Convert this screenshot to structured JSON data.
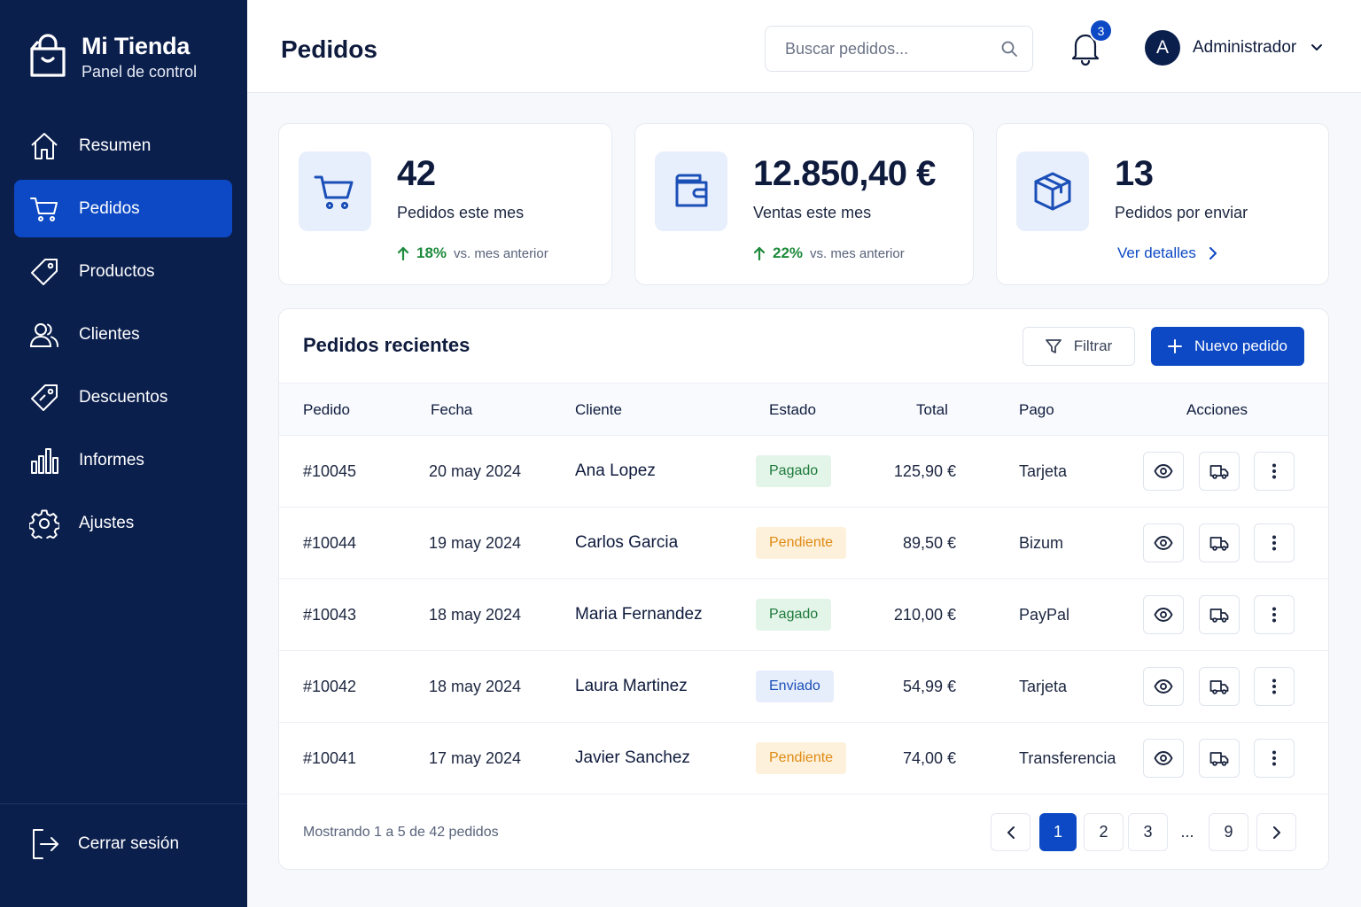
{
  "brand": {
    "name": "Mi Tienda",
    "subtitle": "Panel de control"
  },
  "sidebar": {
    "items": [
      {
        "label": "Resumen",
        "icon": "home-icon",
        "active": false
      },
      {
        "label": "Pedidos",
        "icon": "cart-icon",
        "active": true
      },
      {
        "label": "Productos",
        "icon": "tag-icon",
        "active": false
      },
      {
        "label": "Clientes",
        "icon": "users-icon",
        "active": false
      },
      {
        "label": "Descuentos",
        "icon": "discount-tag-icon",
        "active": false
      },
      {
        "label": "Informes",
        "icon": "bar-chart-icon",
        "active": false
      },
      {
        "label": "Ajustes",
        "icon": "gear-icon",
        "active": false
      }
    ],
    "logout_label": "Cerrar sesión"
  },
  "header": {
    "title": "Pedidos",
    "search_placeholder": "Buscar pedidos...",
    "notifications_count": "3",
    "user_initial": "A",
    "user_name": "Administrador"
  },
  "stats": [
    {
      "value": "42",
      "label": "Pedidos este mes",
      "trend_value": "18%",
      "trend_text": "vs. mes anterior",
      "icon": "cart-icon"
    },
    {
      "value": "12.850,40 €",
      "label": "Ventas este mes",
      "trend_value": "22%",
      "trend_text": "vs. mes anterior",
      "icon": "wallet-icon"
    },
    {
      "value": "13",
      "label": "Pedidos por enviar",
      "link_label": "Ver detalles",
      "icon": "package-icon"
    }
  ],
  "orders": {
    "title": "Pedidos recientes",
    "filter_label": "Filtrar",
    "new_label": "Nuevo pedido",
    "columns": [
      "Pedido",
      "Fecha",
      "Cliente",
      "Estado",
      "Total",
      "Pago",
      "Acciones"
    ],
    "rows": [
      {
        "id": "#10045",
        "date": "20 may 2024",
        "customer": "Ana Lopez",
        "status": "Pagado",
        "status_type": "paid",
        "total": "125,90 €",
        "payment": "Tarjeta"
      },
      {
        "id": "#10044",
        "date": "19 may 2024",
        "customer": "Carlos Garcia",
        "status": "Pendiente",
        "status_type": "pending",
        "total": "89,50 €",
        "payment": "Bizum"
      },
      {
        "id": "#10043",
        "date": "18 may 2024",
        "customer": "Maria Fernandez",
        "status": "Pagado",
        "status_type": "paid",
        "total": "210,00 €",
        "payment": "PayPal"
      },
      {
        "id": "#10042",
        "date": "18 may 2024",
        "customer": "Laura Martinez",
        "status": "Enviado",
        "status_type": "sent",
        "total": "54,99 €",
        "payment": "Tarjeta"
      },
      {
        "id": "#10041",
        "date": "17 may 2024",
        "customer": "Javier Sanchez",
        "status": "Pendiente",
        "status_type": "pending",
        "total": "74,00 €",
        "payment": "Transferencia"
      }
    ],
    "footer_text": "Mostrando 1 a 5 de 42 pedidos",
    "pagination": [
      "1",
      "2",
      "3",
      "...",
      "9"
    ],
    "current_page": "1"
  },
  "colors": {
    "sidebar": "#0b1f4d",
    "accent": "#0d49c4",
    "success": "#1d8a3c",
    "warning": "#e08a12"
  }
}
